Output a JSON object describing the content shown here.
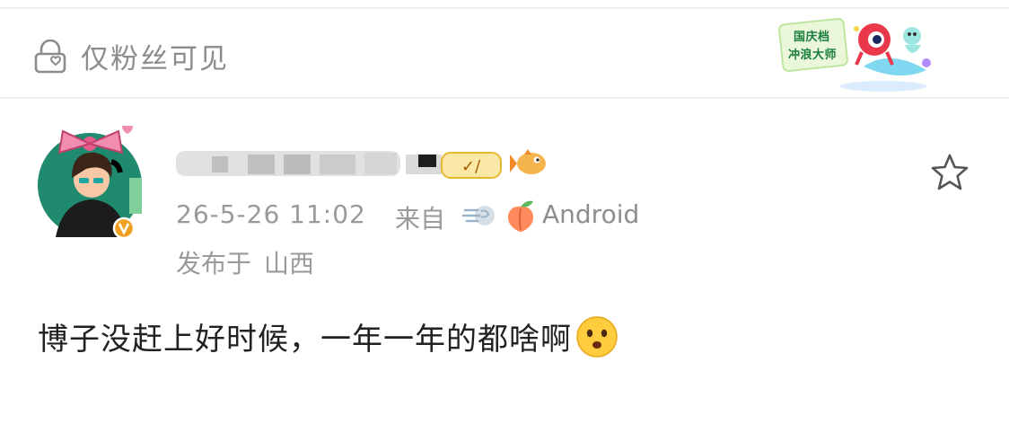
{
  "visibility": {
    "label": "仅粉丝可见",
    "icon": "lock-heart-icon"
  },
  "badge": {
    "line1": "国庆档",
    "line2": "冲浪大师",
    "icon": "surf-master-badge"
  },
  "post": {
    "meta": {
      "time": "26-5-26 11:02",
      "from_label": "来自",
      "device": "Android"
    },
    "location": {
      "label": "发布于",
      "place": "山西"
    },
    "content": "博子没赶上好时候，一年一年的都啥啊",
    "emoji": "frowning-face-emoji"
  },
  "colors": {
    "muted_text": "#9a9a9a",
    "body_text": "#222222",
    "verified": "#f0a020",
    "star": "#555555"
  }
}
